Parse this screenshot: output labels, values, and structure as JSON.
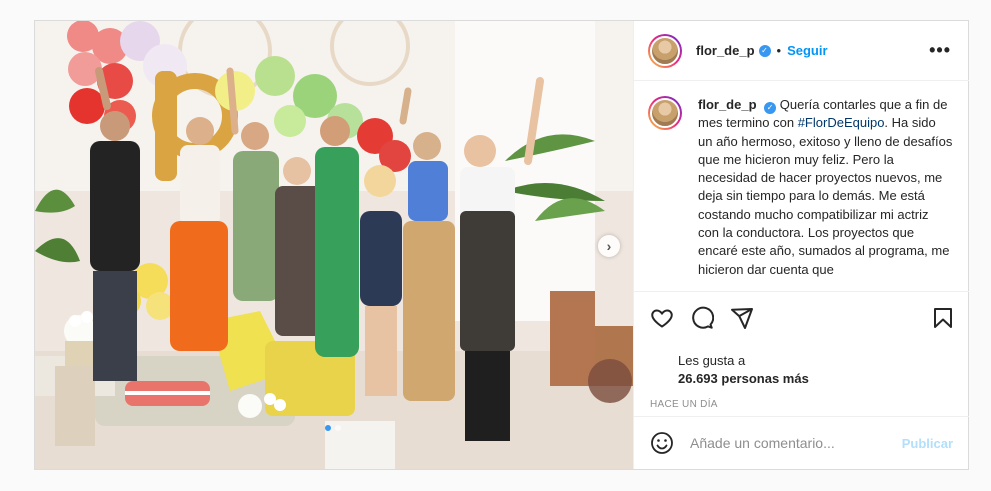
{
  "post": {
    "user": {
      "username": "flor_de_p",
      "verified": true
    },
    "header": {
      "follow_label": "Seguir",
      "separator": "•",
      "more_label": "•••"
    },
    "caption": {
      "username": "flor_de_p",
      "text_before": "Quería contarles que a fin de mes termino con ",
      "hashtag": "#FlorDeEquipo",
      "text_after": ". Ha sido un año hermoso, exitoso y lleno de desafíos que me hicieron muy feliz. Pero la necesidad de hacer proyectos nuevos, me deja sin tiempo para lo demás. Me está costando mucho compatibilizar mi actriz con la conductora. Los proyectos que encaré este año, sumados al programa, me hicieron dar cuenta que"
    },
    "likes": {
      "prefix": "Les gusta a",
      "count_text": "26.693 personas más"
    },
    "timestamp": "HACE UN DÍA",
    "comment": {
      "placeholder": "Añade un comentario...",
      "value": "",
      "publish_label": "Publicar"
    },
    "carousel": {
      "next_icon": "›",
      "slide_count": 2,
      "current_slide": 1
    }
  },
  "colors": {
    "accent": "#0095f6",
    "verified": "#3897f0",
    "hashtag": "#00376b",
    "publish_disabled": "#b2dffc",
    "muted": "#8e8e8e"
  },
  "icons": [
    "verified-icon",
    "more-options-icon",
    "heart-icon",
    "comment-icon",
    "share-icon",
    "bookmark-icon",
    "emoji-icon",
    "chevron-right-icon"
  ]
}
